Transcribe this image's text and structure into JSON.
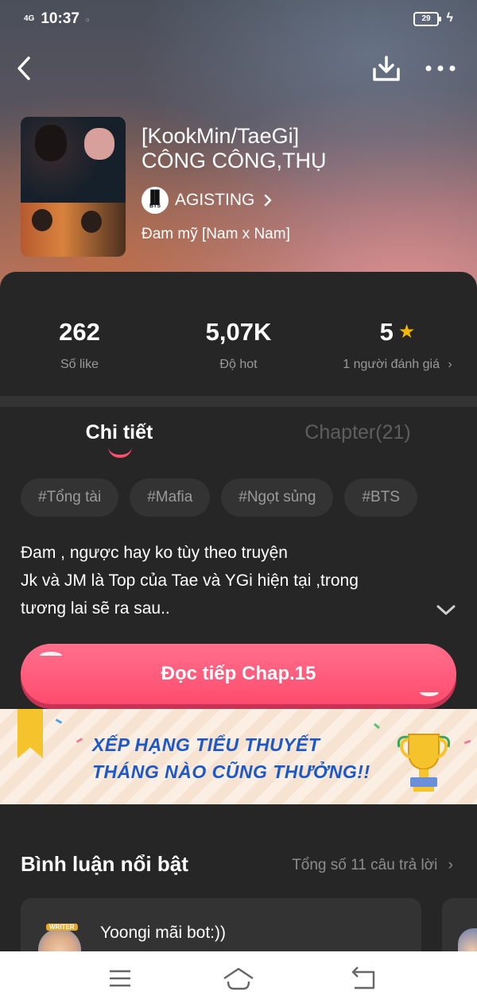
{
  "status_bar": {
    "network": "4G",
    "time": "10:37",
    "battery": "29"
  },
  "header": {
    "back_icon": "chevron-left-icon",
    "download_icon": "download-icon",
    "more_icon": "more-dots-icon"
  },
  "book": {
    "title_line1": "[KookMin/TaeGi]",
    "title_line2": "CÔNG CÔNG,THỤ",
    "author_logo": "BTS",
    "author": "AGISTING",
    "genre": "Đam mỹ [Nam x Nam]"
  },
  "stats": {
    "likes_value": "262",
    "likes_label": "Số like",
    "hot_value": "5,07K",
    "hot_label": "Độ hot",
    "rating_value": "5",
    "rating_label": "1 người đánh giá"
  },
  "tabs": {
    "detail": "Chi tiết",
    "chapters": "Chapter(21)"
  },
  "tags": [
    "#Tổng tài",
    "#Mafia",
    "#Ngọt sủng",
    "#BTS"
  ],
  "description": {
    "line1": "Đam , ngược hay ko tùy theo truyện",
    "line2": "Jk và JM là Top của Tae và YGi hiện tại ,trong",
    "line3": "tương lai sẽ ra sau.."
  },
  "read_button": "Đọc tiếp Chap.15",
  "banner": {
    "line1": "XẾP HẠNG TIỂU THUYẾT",
    "line2": "THÁNG NÀO CŨNG THƯỞNG!!"
  },
  "comments": {
    "title": "Bình luận nổi bật",
    "count": "Tổng số 11 câu trả lời",
    "avatar_badge": "WRITER",
    "first_commenter": "Yoongi mãi bot:))"
  },
  "colors": {
    "accent": "#ff4f72",
    "background": "#262626",
    "star": "#f5b800"
  }
}
